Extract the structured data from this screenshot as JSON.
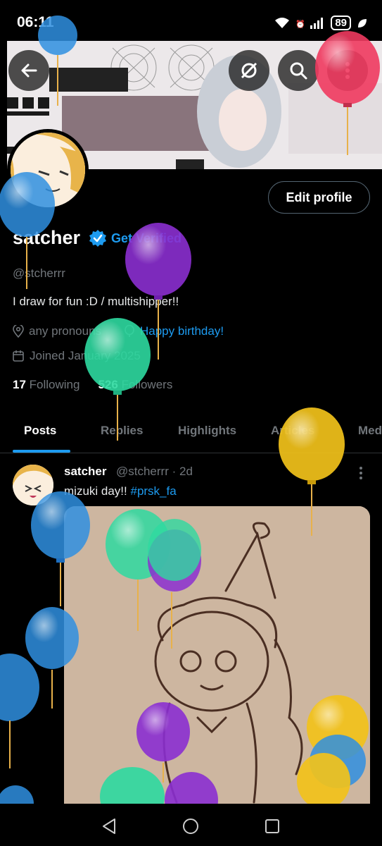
{
  "status_bar": {
    "time": "06:11",
    "battery": "89",
    "icons": [
      "wifi-icon",
      "alarm-icon",
      "signal-icon",
      "battery-icon",
      "leaf-icon"
    ]
  },
  "profile": {
    "name": "satcher",
    "get_verified": "Get Verified",
    "handle": "@stcherrr",
    "bio": "I draw for fun :D  / multishipper!!",
    "pronouns": "any pronouns",
    "birthday": "Happy birthday!",
    "joined": "Joined January 2025",
    "following_count": "17",
    "following_label": "Following",
    "followers_count": "526",
    "followers_label": "Followers",
    "edit_profile": "Edit profile"
  },
  "tabs": [
    {
      "label": "Posts",
      "active": true
    },
    {
      "label": "Replies"
    },
    {
      "label": "Highlights"
    },
    {
      "label": "Articles"
    },
    {
      "label": "Media"
    }
  ],
  "post": {
    "author": "satcher",
    "handle": "@stcherrr",
    "time": "· 2d",
    "text": "mizuki day!! ",
    "hashtag": "#prsk_fa"
  },
  "colors": {
    "accent": "#1d9bf0",
    "muted": "#71767b",
    "balloon_blue": "#2f8fe0",
    "balloon_purple": "#8b2fd0",
    "balloon_green": "#2ed9a0",
    "balloon_yellow": "#f2c21a",
    "balloon_red": "#f03a5f"
  }
}
